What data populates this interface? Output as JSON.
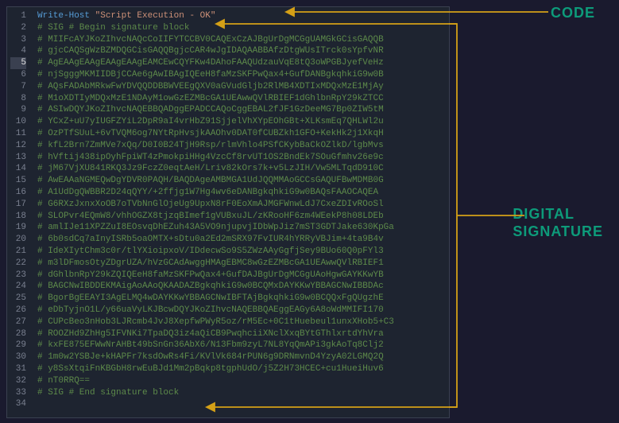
{
  "annotations": {
    "code_label": "CODE",
    "sig_label_line1": "DIGITAL",
    "sig_label_line2": "SIGNATURE"
  },
  "highlighted_line": 5,
  "lines": [
    {
      "n": 1,
      "type": "code",
      "cmd": "Write-Host",
      "str": "\"Script Execution - OK\""
    },
    {
      "n": 2,
      "type": "comment",
      "text": "# SIG # Begin signature block"
    },
    {
      "n": 3,
      "type": "comment",
      "text": "# MIIFcAYJKoZIhvcNAQcCoIIFYTCCBV0CAQExCzAJBgUrDgMCGgUAMGkGCisGAQQB"
    },
    {
      "n": 4,
      "type": "comment",
      "text": "# gjcCAQSgWzBZMDQGCisGAQQBgjcCAR4wJgIDAQAABBAfzDtgWUsITrck0sYpfvNR"
    },
    {
      "n": 5,
      "type": "comment",
      "text": "# AgEAAgEAAgEAAgEAAgEAMCEwCQYFKw4DAhoFAAQUdzauVqE8tQ3oWPGBJyefVeHz"
    },
    {
      "n": 6,
      "type": "comment",
      "text": "# njSgggMKMIIDBjCCAe6gAwIBAgIQEeH8faMzSKFPwQax4+GufDANBgkqhkiG9w0B"
    },
    {
      "n": 7,
      "type": "comment",
      "text": "# AQsFADAbMRkwFwYDVQQDDBBWVEEgQXV0aGVudGljb2RlMB4XDTIxMDQxMzE1MjAy"
    },
    {
      "n": 8,
      "type": "comment",
      "text": "# M1oXDTIyMDQxMzE1NDAyM1owGzEZMBcGA1UEAwwQVlRBIEF1dGhlbnRpY29kZTCC"
    },
    {
      "n": 9,
      "type": "comment",
      "text": "# ASIwDQYJKoZIhvcNAQEBBQADggEPADCCAQoCggEBAL2fJF1GzDeeMG7Bp0ZIW5tM"
    },
    {
      "n": 10,
      "type": "comment",
      "text": "# YCxZ+uU7yIUGFZYiL2DpR9aI4vrHbZ91SjjelVhXYpEOhGBt+XLKsmEq7QHLWl2u"
    },
    {
      "n": 11,
      "type": "comment",
      "text": "# OzPTfSUuL+6vTVQM6og7NYtRpHvsjkAAOhv0DAT0fCUBZkh1GFO+KekHk2j1XkqH"
    },
    {
      "n": 12,
      "type": "comment",
      "text": "# kfL2Brn7ZmMVe7xQq/D0I0B24TjH9Rsp/rlmVhlo4PSfCKybBaCkOZlkD/lgbMvs"
    },
    {
      "n": 13,
      "type": "comment",
      "text": "# hVftij438ipOyhFpiWT4zPmokpiHHg4VzcCf8rvUT1OS2BndEk7SOuGfmhv26e9c"
    },
    {
      "n": 14,
      "type": "comment",
      "text": "# jM67VjXU841RKQ3Jz9FczZ0eqtAeH/Lriv82kOrs7k+v5LzJIH/Vw5MLTqdD910C"
    },
    {
      "n": 15,
      "type": "comment",
      "text": "# AwEAAaNGMEQwDgYDVR0PAQH/BAQDAgeAMBMGA1UdJQQMMAoGCCsGAQUFBwMDMB0G"
    },
    {
      "n": 16,
      "type": "comment",
      "text": "# A1UdDgQWBBR2D24qQYY/+2ffjg1W7Hg4wv6eDANBgkqhkiG9w0BAQsFAAOCAQEA"
    },
    {
      "n": 17,
      "type": "comment",
      "text": "# G6RXzJxnxXoOB7oTVbNnGlOjeUg9UpxN8rF0EoXmAJMGFWnwLdJ7CxeZDIvROoSl"
    },
    {
      "n": 18,
      "type": "comment",
      "text": "# SLOPvr4EQmW8/vhhOGZX8tjzqBImef1gVUBxuJL/zKRooHF6zm4WEekP8h08LDEb"
    },
    {
      "n": 19,
      "type": "comment",
      "text": "# amlIJe11XPZZuI8EOsvqDhEZuh43A5VO9njupvjIDbWpJiz7mST3GDTJake630KpGa"
    },
    {
      "n": 20,
      "type": "comment",
      "text": "# 6b0sdCq7aInyISRb5oaOMTX+sDtu0a2Ed2mSRX97FvIUR4hYRRyVBJim+4ta9B4v"
    },
    {
      "n": 21,
      "type": "comment",
      "text": "# IdeXIytChm3c0r/tlYXioipxoV/IDdecwSo9S5ZWzAAyGgfjSey9BUo60Q0pFYl3"
    },
    {
      "n": 22,
      "type": "comment",
      "text": "# m3lDFmosOtyZDgrUZA/hVzGCAdAwggHMAgEBMC8wGzEZMBcGA1UEAwwQVlRBIEF1"
    },
    {
      "n": 23,
      "type": "comment",
      "text": "# dGhlbnRpY29kZQIQEeH8faMzSKFPwQax4+GufDAJBgUrDgMCGgUAoHgwGAYKKwYB"
    },
    {
      "n": 24,
      "type": "comment",
      "text": "# BAGCNwIBDDEKMAigAoAAoQKAADAZBgkqhkiG9w0BCQMxDAYKKwYBBAGCNwIBBDAc"
    },
    {
      "n": 25,
      "type": "comment",
      "text": "# BgorBgEEAYI3AgELMQ4wDAYKKwYBBAGCNwIBFTAjBgkqhkiG9w0BCQQxFgQUgzhE"
    },
    {
      "n": 26,
      "type": "comment",
      "text": "# eDbTyjnO1L/y66uaVyLKJBcwDQYJKoZIhvcNAQEBBQAEggEAGy6A8oWdMMIFI170"
    },
    {
      "n": 27,
      "type": "comment",
      "text": "# CUPcBeo3nHob3LJRcmb4JvJ8XepfwPWyR5oz/rM5Ec+0C1tHuebeul1unxXHob5+C3"
    },
    {
      "n": 28,
      "type": "comment",
      "text": "# ROOZHd9ZhHg5IFVNKi7TpaDQ3iz4aQiCB9PwqhciiXNclXxqBYtGThlxrtdYhVra"
    },
    {
      "n": 29,
      "type": "comment",
      "text": "# kxFE875EFWwNrAHBt49bSnGn36AbX6/N13Fbm9zyL7NL8YqQmAPi3gkAoTq8Clj2"
    },
    {
      "n": 30,
      "type": "comment",
      "text": "# 1m0w2YSBJe+kHAPFr7ksdOwRs4Fi/KVlVk684rPUN6g9DRNmvnD4YzyA02LGMQ2Q"
    },
    {
      "n": 31,
      "type": "comment",
      "text": "# y8SsXtqiFnKBGbH8rwEuBJd1Mm2pBqkp8tgphUdO/j5Z2H73HCEC+cu1HueiHuv6"
    },
    {
      "n": 32,
      "type": "comment",
      "text": "# nT0RRQ=="
    },
    {
      "n": 33,
      "type": "comment",
      "text": "# SIG # End signature block"
    },
    {
      "n": 34,
      "type": "blank",
      "text": ""
    }
  ]
}
